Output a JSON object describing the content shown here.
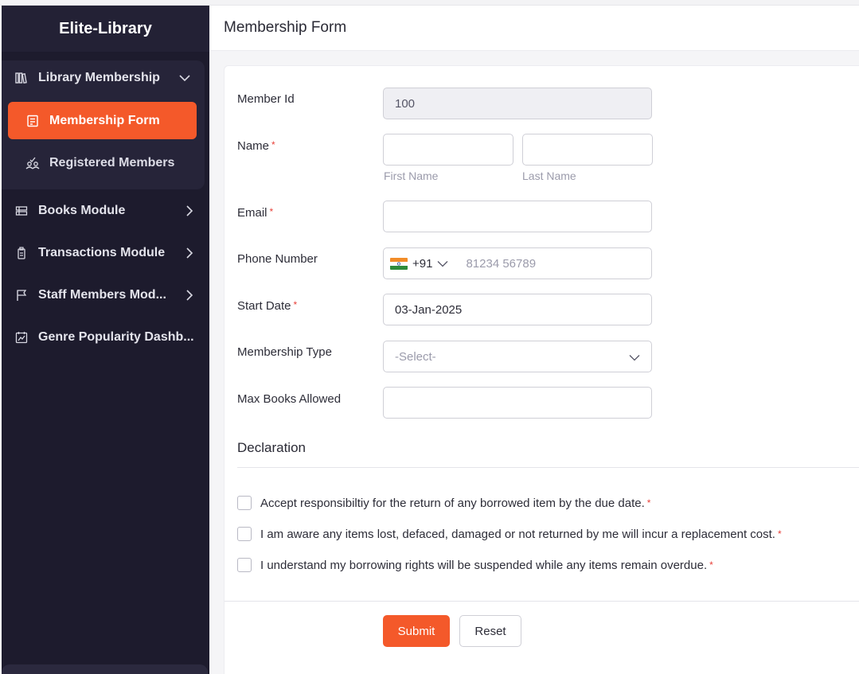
{
  "app": {
    "brand": "Elite-Library"
  },
  "sidebar": {
    "group": {
      "label": "Library Membership",
      "items": [
        {
          "label": "Membership Form",
          "active": true
        },
        {
          "label": "Registered Members",
          "active": false
        }
      ]
    },
    "items": [
      {
        "label": "Books Module"
      },
      {
        "label": "Transactions Module"
      },
      {
        "label": "Staff Members Mod..."
      },
      {
        "label": "Genre Popularity Dashb..."
      }
    ]
  },
  "header": {
    "title": "Membership Form"
  },
  "form": {
    "member_id": {
      "label": "Member Id",
      "value": "100"
    },
    "name": {
      "label": "Name",
      "first_hint": "First Name",
      "last_hint": "Last Name",
      "first_value": "",
      "last_value": ""
    },
    "email": {
      "label": "Email",
      "value": ""
    },
    "phone": {
      "label": "Phone Number",
      "code": "+91",
      "placeholder": "81234 56789"
    },
    "start_date": {
      "label": "Start Date",
      "value": "03-Jan-2025"
    },
    "membership_type": {
      "label": "Membership Type",
      "placeholder": "-Select-"
    },
    "max_books": {
      "label": "Max Books Allowed",
      "value": ""
    },
    "required_mark": "*"
  },
  "declaration": {
    "title": "Declaration",
    "items": [
      "Accept responsibiltiy for the return of any borrowed item by the due date.",
      "I am aware any items lost, defaced, damaged or not returned by me will incur a replacement cost.",
      "I understand my borrowing rights will be suspended while any items remain overdue."
    ]
  },
  "buttons": {
    "submit": "Submit",
    "reset": "Reset"
  },
  "colors": {
    "accent": "#f4592a",
    "sidebar_bg": "#1d1b2d",
    "required": "#e8413a"
  },
  "icons": {
    "library_membership": "library-books-icon",
    "membership_form": "form-icon",
    "registered_members": "members-icon",
    "books_module": "books-icon",
    "transactions_module": "transactions-icon",
    "staff_members": "staff-icon",
    "genre_dashboard": "dashboard-chart-icon"
  }
}
